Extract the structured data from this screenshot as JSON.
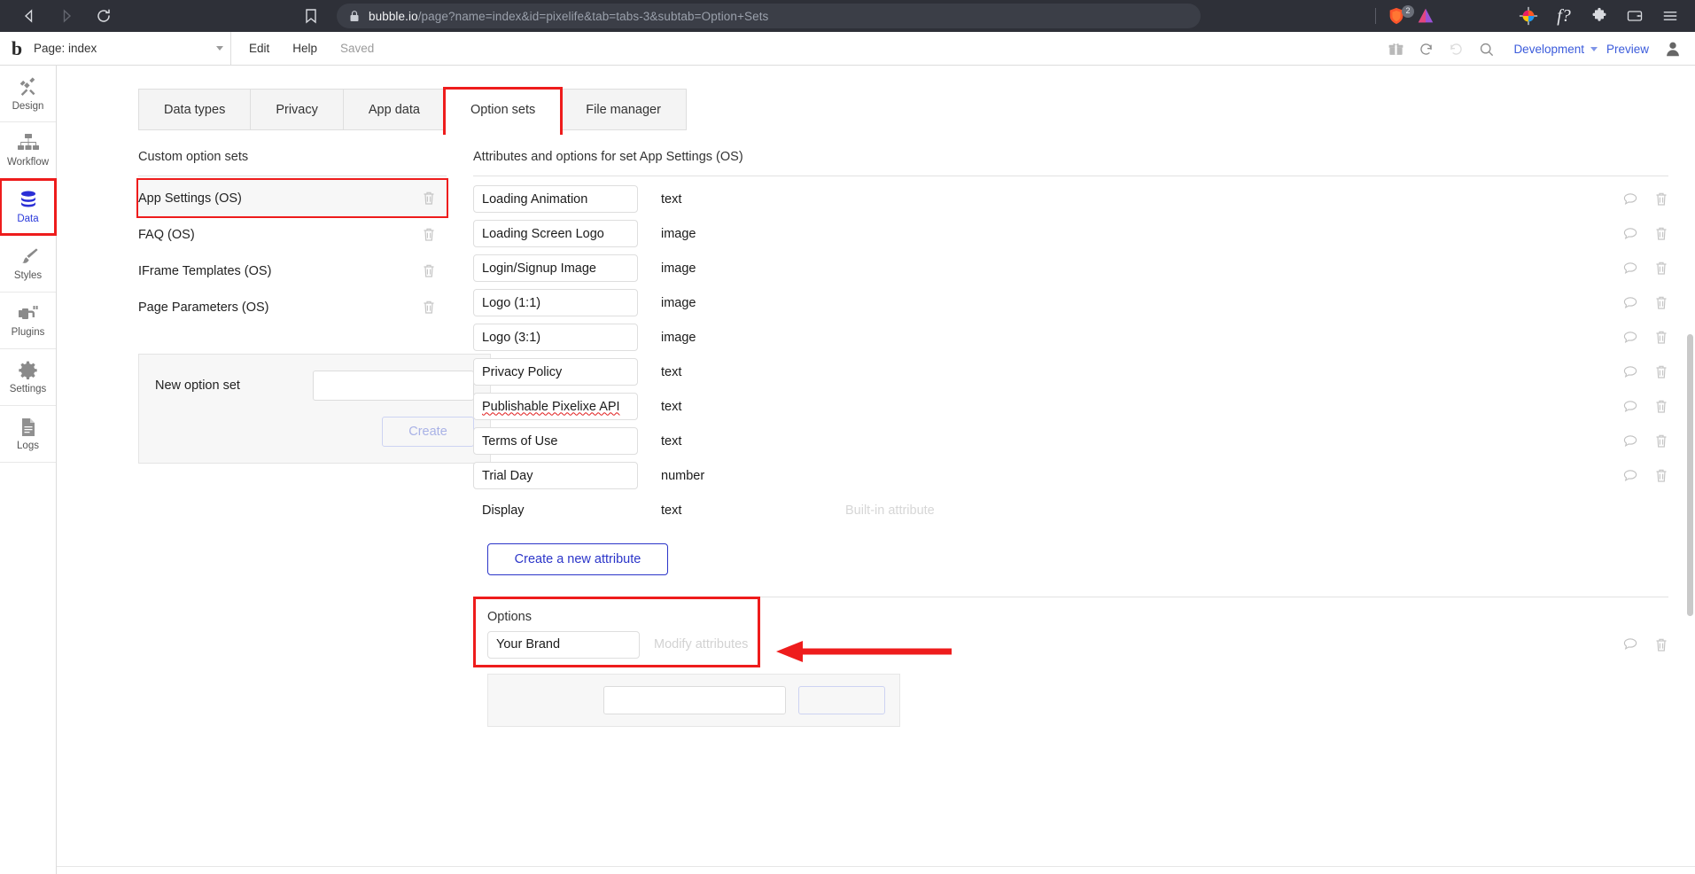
{
  "browser": {
    "url_host": "bubble.io",
    "url_path": "/page?name=index&id=pixelife&tab=tabs-3&subtab=Option+Sets",
    "back_icon": "back-arrow-icon",
    "forward_icon": "forward-arrow-icon",
    "reload_icon": "reload-icon",
    "bookmark_icon": "bookmark-icon",
    "lock_icon": "lock-icon",
    "shield_badge": "2",
    "icons": [
      "brave-shield-icon",
      "brave-rewards-icon",
      "color-wheel-icon",
      "f-question-icon",
      "extensions-puzzle-icon",
      "wallet-icon",
      "browser-menu-icon"
    ]
  },
  "appbar": {
    "logo": "b",
    "page_label": "Page: index",
    "menu": [
      {
        "label": "Edit"
      },
      {
        "label": "Help"
      },
      {
        "label": "Saved"
      }
    ],
    "gift_icon": "gift-icon",
    "undo_icon": "undo-icon",
    "redo_icon": "redo-icon",
    "search_icon": "search-icon",
    "version": "Development",
    "preview": "Preview",
    "avatar": "user-avatar-icon"
  },
  "sidebar": {
    "items": [
      {
        "label": "Design",
        "icon": "design-icon",
        "active": false
      },
      {
        "label": "Workflow",
        "icon": "workflow-icon",
        "active": false
      },
      {
        "label": "Data",
        "icon": "database-icon",
        "active": true
      },
      {
        "label": "Styles",
        "icon": "paintbrush-icon",
        "active": false
      },
      {
        "label": "Plugins",
        "icon": "plug-icon",
        "active": false
      },
      {
        "label": "Settings",
        "icon": "gear-icon",
        "active": false
      },
      {
        "label": "Logs",
        "icon": "document-icon",
        "active": false
      }
    ]
  },
  "tabs": [
    {
      "label": "Data types",
      "active": false
    },
    {
      "label": "Privacy",
      "active": false
    },
    {
      "label": "App data",
      "active": false
    },
    {
      "label": "Option sets",
      "active": true
    },
    {
      "label": "File manager",
      "active": false
    }
  ],
  "left_panel": {
    "title": "Custom option sets",
    "option_sets": [
      {
        "name": "App Settings (OS)",
        "selected": true
      },
      {
        "name": "FAQ (OS)",
        "selected": false
      },
      {
        "name": "IFrame Templates (OS)",
        "selected": false
      },
      {
        "name": "Page Parameters (OS)",
        "selected": false
      }
    ],
    "new_option_set": {
      "label": "New option set",
      "value": "",
      "placeholder": "",
      "create_label": "Create"
    },
    "delete_icon": "trash-icon"
  },
  "right_panel": {
    "title": "Attributes and options for set App Settings (OS)",
    "attributes": [
      {
        "name": "Loading Animation",
        "type": "text",
        "builtin": false,
        "note": "",
        "misspelled": ""
      },
      {
        "name": "Loading Screen Logo",
        "type": "image",
        "builtin": false,
        "note": "",
        "misspelled": ""
      },
      {
        "name": "Login/Signup Image",
        "type": "image",
        "builtin": false,
        "note": "",
        "misspelled": ""
      },
      {
        "name": "Logo (1:1)",
        "type": "image",
        "builtin": false,
        "note": "",
        "misspelled": ""
      },
      {
        "name": "Logo (3:1)",
        "type": "image",
        "builtin": false,
        "note": "",
        "misspelled": ""
      },
      {
        "name": "Privacy Policy",
        "type": "text",
        "builtin": false,
        "note": "",
        "misspelled": ""
      },
      {
        "name": "Publishable Pixelixe API",
        "type": "text",
        "builtin": false,
        "note": "",
        "misspelled": "Pixelixe"
      },
      {
        "name": "Terms of Use",
        "type": "text",
        "builtin": false,
        "note": "",
        "misspelled": ""
      },
      {
        "name": "Trial Day",
        "type": "number",
        "builtin": false,
        "note": "",
        "misspelled": ""
      },
      {
        "name": "Display",
        "type": "text",
        "builtin": true,
        "note": "Built-in attribute",
        "misspelled": ""
      }
    ],
    "create_attribute_label": "Create a new attribute",
    "options_title": "Options",
    "options": [
      {
        "name": "Your Brand",
        "modify_label": "Modify attributes"
      }
    ],
    "comment_icon": "comment-icon",
    "delete_icon": "trash-icon"
  },
  "annotations": {
    "highlight_color": "#ee1c1c",
    "arrow": "red-arrow-pointing-left"
  }
}
